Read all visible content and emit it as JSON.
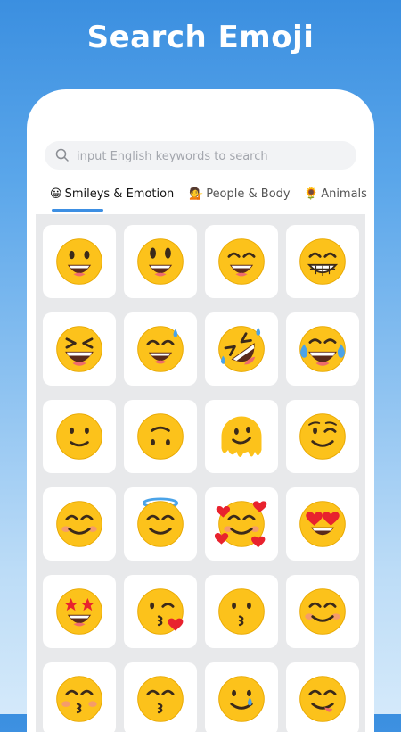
{
  "header": {
    "title": "Search Emoji"
  },
  "search": {
    "placeholder": "input English keywords to search"
  },
  "tabs": [
    {
      "icon": "😀",
      "label": "Smileys & Emotion",
      "active": true
    },
    {
      "icon": "💁",
      "label": "People & Body",
      "active": false
    },
    {
      "icon": "🌻",
      "label": "Animals",
      "active": false
    }
  ],
  "emojis": [
    "grinning-face",
    "grinning-face-big-eyes",
    "grinning-face-smiling-eyes",
    "beaming-face",
    "grinning-squinting-face",
    "grinning-face-sweat",
    "rolling-on-floor-laughing",
    "face-with-tears-of-joy",
    "slightly-smiling-face",
    "upside-down-face",
    "melting-face",
    "winking-face",
    "smiling-face-smiling-eyes",
    "smiling-face-halo",
    "smiling-face-hearts",
    "heart-eyes",
    "star-struck",
    "face-blowing-kiss",
    "kissing-face",
    "smiling-face",
    "kissing-face-closed-eyes",
    "kissing-face-smiling-eyes",
    "smiling-face-tear",
    "face-savoring-food"
  ],
  "colors": {
    "accent": "#3d8fe3",
    "emoji_yellow": "#fcc21b"
  }
}
